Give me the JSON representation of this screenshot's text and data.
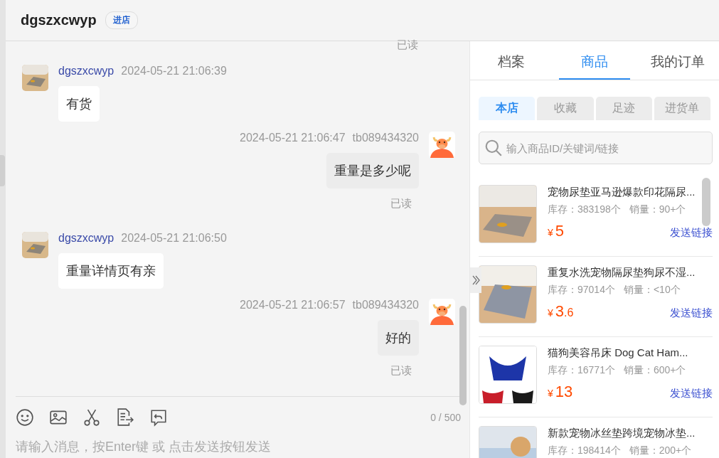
{
  "chat": {
    "title": "dgszxcwyp",
    "badge": "进店",
    "messages": [
      {
        "kind": "receipt",
        "text": "已读"
      },
      {
        "kind": "incoming",
        "sender": "dgszxcwyp",
        "time": "2024-05-21 21:06:39",
        "text": "有货"
      },
      {
        "kind": "outgoing",
        "sender": "tb089434320",
        "time": "2024-05-21 21:06:47",
        "text": "重量是多少呢",
        "receipt": "已读"
      },
      {
        "kind": "incoming",
        "sender": "dgszxcwyp",
        "time": "2024-05-21 21:06:50",
        "text": "重量详情页有亲"
      },
      {
        "kind": "outgoing",
        "sender": "tb089434320",
        "time": "2024-05-21 21:06:57",
        "text": "好的",
        "receipt": "已读"
      }
    ],
    "counter": "0 / 500",
    "placeholder": "请输入消息，按Enter键 或 点击发送按钮发送"
  },
  "side_panel": {
    "tabs": [
      {
        "label": "档案",
        "selected": false
      },
      {
        "label": "商品",
        "selected": true
      },
      {
        "label": "我的订单",
        "selected": false
      }
    ],
    "subtabs": [
      {
        "label": "本店",
        "selected": true
      },
      {
        "label": "收藏",
        "selected": false
      },
      {
        "label": "足迹",
        "selected": false
      },
      {
        "label": "进货单",
        "selected": false
      }
    ],
    "search": {
      "placeholder": "输入商品ID/关键词/链接"
    },
    "products": [
      {
        "title": "宠物尿垫亚马逊爆款印花隔尿...",
        "stock": "库存：383198个",
        "sales": "销量：90+个",
        "currency": "¥",
        "price": "5",
        "action": "发送链接"
      },
      {
        "title": "重复水洗宠物隔尿垫狗尿不湿...",
        "stock": "库存：97014个",
        "sales": "销量：<10个",
        "currency": "¥",
        "price": "3",
        "price_decimal": ".6",
        "action": "发送链接"
      },
      {
        "title": "猫狗美容吊床 Dog Cat Ham...",
        "stock": "库存：16771个",
        "sales": "销量：600+个",
        "currency": "¥",
        "price": "13",
        "action": "发送链接"
      },
      {
        "title": "新款宠物冰丝垫跨境宠物冰垫...",
        "stock": "库存：198414个",
        "sales": "销量：200+个"
      }
    ]
  }
}
